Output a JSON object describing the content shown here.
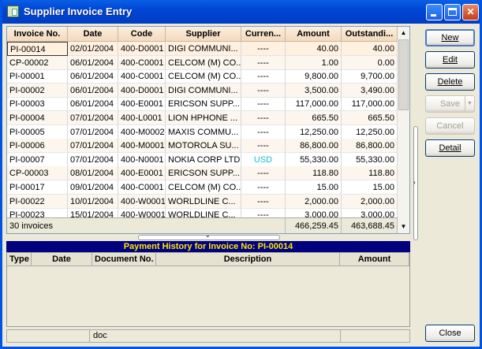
{
  "window": {
    "title": "Supplier Invoice Entry"
  },
  "grid": {
    "columns": [
      "Invoice No.",
      "Date",
      "Code",
      "Supplier",
      "Curren...",
      "Amount",
      "Outstandi..."
    ],
    "rows": [
      [
        "PI-00014",
        "02/01/2004",
        "400-D0001",
        "DIGI COMMUNI...",
        "----",
        "40.00",
        "40.00"
      ],
      [
        "CP-00002",
        "06/01/2004",
        "400-C0001",
        "CELCOM (M) CO...",
        "----",
        "1.00",
        "0.00"
      ],
      [
        "PI-00001",
        "06/01/2004",
        "400-C0001",
        "CELCOM (M) CO...",
        "----",
        "9,800.00",
        "9,700.00"
      ],
      [
        "PI-00002",
        "06/01/2004",
        "400-D0001",
        "DIGI COMMUNI...",
        "----",
        "3,500.00",
        "3,490.00"
      ],
      [
        "PI-00003",
        "06/01/2004",
        "400-E0001",
        "ERICSON SUPP...",
        "----",
        "117,000.00",
        "117,000.00"
      ],
      [
        "PI-00004",
        "07/01/2004",
        "400-L0001",
        "LION HPHONE ...",
        "----",
        "665.50",
        "665.50"
      ],
      [
        "PI-00005",
        "07/01/2004",
        "400-M0002",
        "MAXIS COMMU...",
        "----",
        "12,250.00",
        "12,250.00"
      ],
      [
        "PI-00006",
        "07/01/2004",
        "400-M0001",
        "MOTOROLA SU...",
        "----",
        "86,800.00",
        "86,800.00"
      ],
      [
        "PI-00007",
        "07/01/2004",
        "400-N0001",
        "NOKIA CORP LTD",
        "USD",
        "55,330.00",
        "55,330.00"
      ],
      [
        "CP-00003",
        "08/01/2004",
        "400-E0001",
        "ERICSON SUPP...",
        "----",
        "118.80",
        "118.80"
      ],
      [
        "PI-00017",
        "09/01/2004",
        "400-C0001",
        "CELCOM (M) CO...",
        "----",
        "15.00",
        "15.00"
      ],
      [
        "PI-00022",
        "10/01/2004",
        "400-W0001",
        "WORLDLINE C...",
        "----",
        "2,000.00",
        "2,000.00"
      ],
      [
        "PI-00023",
        "15/01/2004",
        "400-W0001",
        "WORLDLINE C...",
        "----",
        "3,000.00",
        "3,000.00"
      ]
    ],
    "footer": {
      "count": "30 invoices",
      "amount_total": "466,259.45",
      "outstanding_total": "463,688.45"
    }
  },
  "payment_history": {
    "title": "Payment History for Invoice No: PI-00014",
    "columns": [
      "Type",
      "Date",
      "Document No.",
      "Description",
      "Amount"
    ]
  },
  "status": {
    "seg2": "doc"
  },
  "buttons": {
    "new": "New",
    "edit": "Edit",
    "delete": "Delete",
    "save": "Save",
    "cancel": "Cancel",
    "detail": "Detail",
    "close": "Close"
  }
}
